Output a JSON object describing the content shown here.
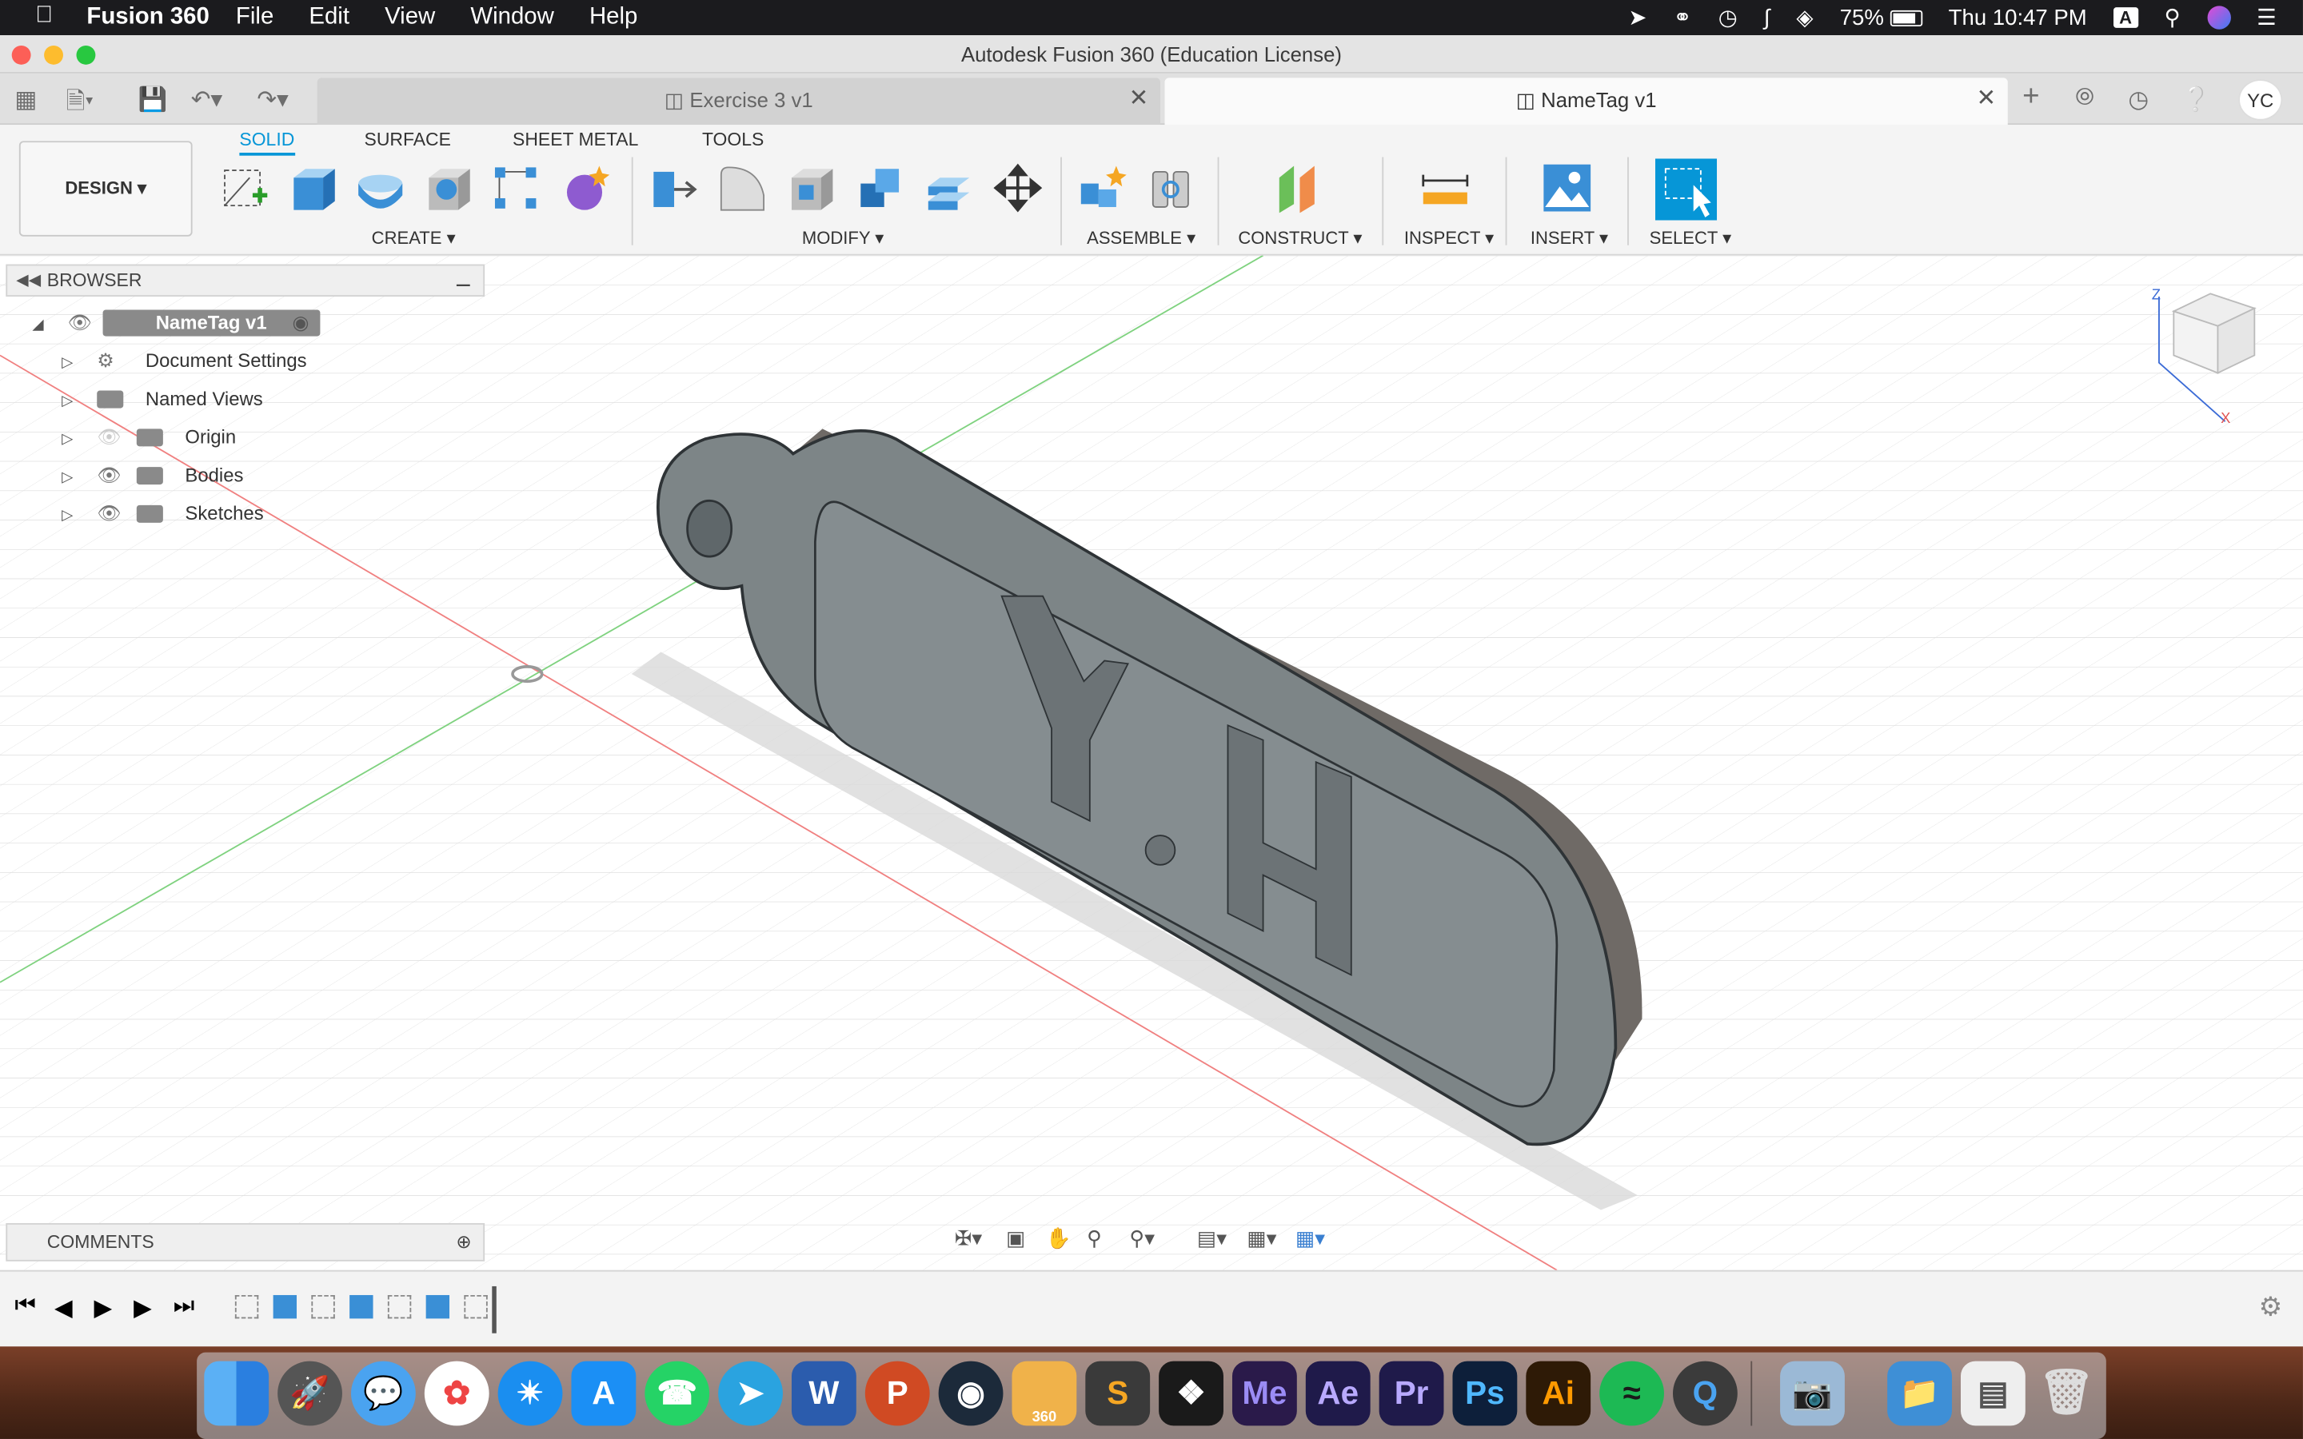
{
  "menubar": {
    "app_name": "Fusion 360",
    "menus": [
      "File",
      "Edit",
      "View",
      "Window",
      "Help"
    ],
    "battery": "75%",
    "clock": "Thu 10:47 PM",
    "input_source": "A"
  },
  "window": {
    "title": "Autodesk Fusion 360 (Education License)"
  },
  "tabs": [
    {
      "label": "Exercise 3 v1",
      "active": false
    },
    {
      "label": "NameTag v1",
      "active": true
    }
  ],
  "user_initials": "YC",
  "workspace": {
    "label": "DESIGN ▾"
  },
  "toolbar_tabs": [
    "SOLID",
    "SURFACE",
    "SHEET METAL",
    "TOOLS"
  ],
  "toolbar_groups": [
    "CREATE ▾",
    "MODIFY ▾",
    "ASSEMBLE ▾",
    "CONSTRUCT ▾",
    "INSPECT ▾",
    "INSERT ▾",
    "SELECT ▾"
  ],
  "browser": {
    "title": "BROWSER",
    "root": "NameTag v1",
    "items": [
      "Document Settings",
      "Named Views",
      "Origin",
      "Bodies",
      "Sketches"
    ]
  },
  "comments": {
    "title": "COMMENTS"
  },
  "model": {
    "text": "Y.H",
    "fill": "#7d8587"
  },
  "dock_apps": [
    "Finder",
    "Launchpad",
    "Messages",
    "Photos",
    "Safari",
    "App Store",
    "WhatsApp",
    "Telegram",
    "Word",
    "PowerPoint",
    "Cinema 4D",
    "Fusion 360",
    "Sublime Text",
    "Acrobat",
    "Me",
    "Ae",
    "Pr",
    "Ps",
    "Ai",
    "Spotify",
    "QuickTime",
    "Preview",
    "Folder",
    "Screenshot",
    "Trash"
  ],
  "dock_labels": {
    "fusion": "360",
    "me": "Me",
    "ae": "Ae",
    "pr": "Pr",
    "ps": "Ps",
    "ai": "Ai",
    "word": "W",
    "ppt": "P"
  }
}
